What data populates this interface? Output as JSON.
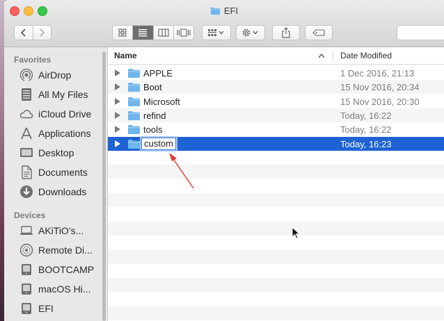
{
  "window": {
    "title": "EFI"
  },
  "sidebar": {
    "favorites_heading": "Favorites",
    "favorites": [
      {
        "label": "AirDrop",
        "icon": "airdrop-icon"
      },
      {
        "label": "All My Files",
        "icon": "all-my-files-icon"
      },
      {
        "label": "iCloud Drive",
        "icon": "icloud-icon"
      },
      {
        "label": "Applications",
        "icon": "applications-icon"
      },
      {
        "label": "Desktop",
        "icon": "desktop-icon"
      },
      {
        "label": "Documents",
        "icon": "documents-icon"
      },
      {
        "label": "Downloads",
        "icon": "downloads-icon"
      }
    ],
    "devices_heading": "Devices",
    "devices": [
      {
        "label": "AKiTiO’s...",
        "icon": "laptop-icon"
      },
      {
        "label": "Remote Di...",
        "icon": "remote-disc-icon"
      },
      {
        "label": "BOOTCAMP",
        "icon": "drive-icon"
      },
      {
        "label": "macOS Hi...",
        "icon": "drive-icon"
      },
      {
        "label": "EFI",
        "icon": "drive-icon"
      }
    ]
  },
  "columns": {
    "name": "Name",
    "date_modified": "Date Modified"
  },
  "files": [
    {
      "name": "APPLE",
      "date": "1 Dec 2016, 21:13"
    },
    {
      "name": "Boot",
      "date": "15 Nov 2016, 20:34"
    },
    {
      "name": "Microsoft",
      "date": "15 Nov 2016, 20:30"
    },
    {
      "name": "refind",
      "date": "Today, 16:22"
    },
    {
      "name": "tools",
      "date": "Today, 16:22"
    },
    {
      "name": "custom",
      "date": "Today, 16:23",
      "selected": true,
      "renaming": true
    }
  ],
  "colors": {
    "selection": "#1e63d3",
    "folder": "#6fb6ec",
    "annotation_arrow": "#e03a2f"
  }
}
